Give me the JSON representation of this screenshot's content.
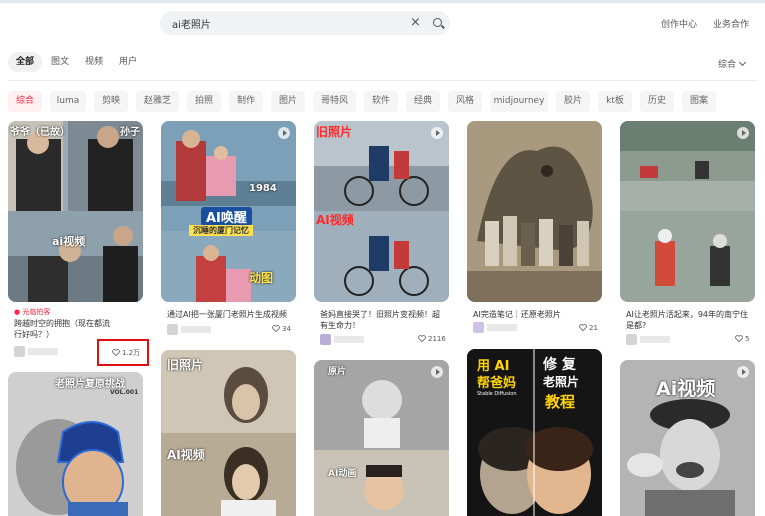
{
  "search": {
    "query": "ai老照片"
  },
  "header": {
    "creator_center": "创作中心",
    "business": "业务合作"
  },
  "tabs": [
    {
      "label": "全部",
      "active": true
    },
    {
      "label": "图文",
      "active": false
    },
    {
      "label": "视频",
      "active": false
    },
    {
      "label": "用户",
      "active": false
    }
  ],
  "sort_label": "综合",
  "tags": [
    "综合",
    "luma",
    "剪映",
    "赵雅芝",
    "拍照",
    "制作",
    "图片",
    "哥特风",
    "软件",
    "经典",
    "风格",
    "midjourney",
    "胶片",
    "kt板",
    "历史",
    "图案"
  ],
  "colors": {
    "accent": "#ff2442",
    "highlight_box": "#e01010"
  },
  "cards": [
    {
      "overlays": [
        "爷爷（已故）",
        "孙子",
        "ai视频"
      ],
      "badge": "光临拍客",
      "caption": "跨越时空的拥抱（现在都流行好吗？）",
      "likes": "1.2万"
    },
    {
      "overlays": [
        "1984",
        "AI唤醒",
        "沉睡的厦门记忆",
        "动图"
      ],
      "caption": "通过AI把一张厦门老照片生成视频",
      "likes": "34"
    },
    {
      "overlays": [
        "旧照片",
        "AI视频"
      ],
      "caption": "爸妈直接哭了！旧照片变视频！超有生命力！",
      "likes": "2116"
    },
    {
      "overlays": [],
      "caption": "AI完造笔记｜还原老照片",
      "likes": "21"
    },
    {
      "overlays": [],
      "caption": "AI让老照片活起来，94年的南宁住是都?",
      "likes": "5"
    },
    {
      "overlays": [
        "老照片复原挑战",
        "VOL.001"
      ]
    },
    {
      "overlays": [
        "旧照片",
        "AI视频"
      ]
    },
    {
      "overlays": [
        "原片",
        "AI动画"
      ]
    },
    {
      "overlays": [
        "用 AI",
        "帮爸妈",
        "Stable Diffusion",
        "修 复",
        "老照片",
        "教程"
      ]
    },
    {
      "overlays": [
        "Ai视频"
      ]
    }
  ]
}
